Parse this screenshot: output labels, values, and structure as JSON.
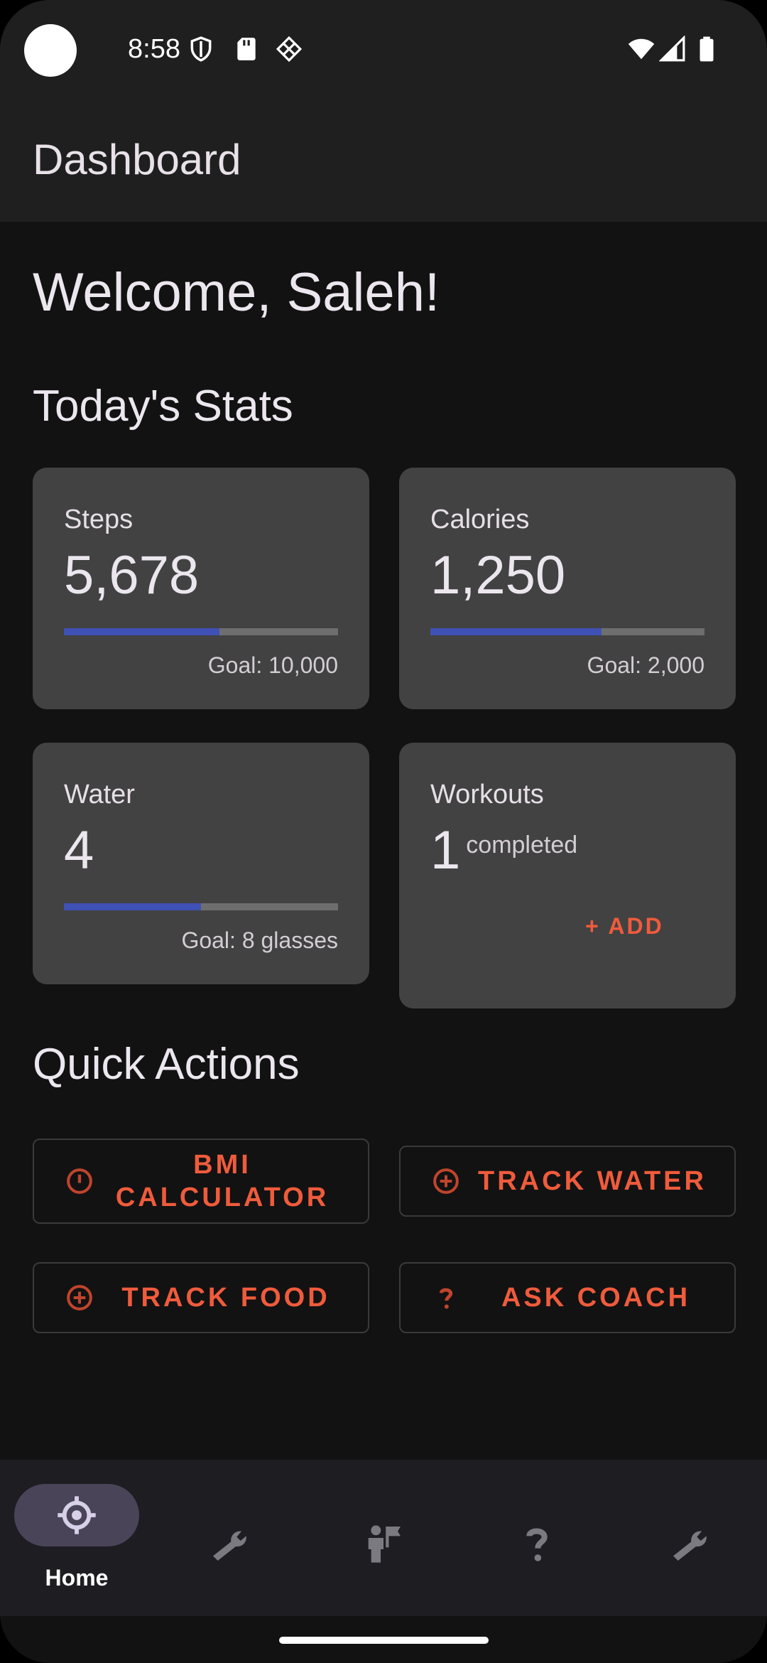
{
  "status_bar": {
    "time": "8:58"
  },
  "app_bar": {
    "title": "Dashboard"
  },
  "welcome": "Welcome, Saleh!",
  "stats": {
    "title": "Today's Stats",
    "steps": {
      "label": "Steps",
      "value": "5,678",
      "goal": "Goal: 10,000",
      "progress": 0.5678
    },
    "calories": {
      "label": "Calories",
      "value": "1,250",
      "goal": "Goal: 2,000",
      "progress": 0.625
    },
    "water": {
      "label": "Water",
      "value": "4",
      "goal": "Goal: 8 glasses",
      "progress": 0.5
    },
    "workouts": {
      "label": "Workouts",
      "value": "1",
      "unit": "completed",
      "add_label": "+ ADD"
    }
  },
  "quick_actions": {
    "title": "Quick Actions",
    "bmi_line1": "BMI",
    "bmi_line2": "CALCULATOR",
    "track_water": "TRACK WATER",
    "track_food": "TRACK FOOD",
    "ask_coach": "ASK COACH"
  },
  "bottom_nav": {
    "home_label": "Home"
  },
  "colors": {
    "accent": "#ef5b3c",
    "progress": "#3f51b5",
    "card": "#424242",
    "background": "#121212"
  }
}
